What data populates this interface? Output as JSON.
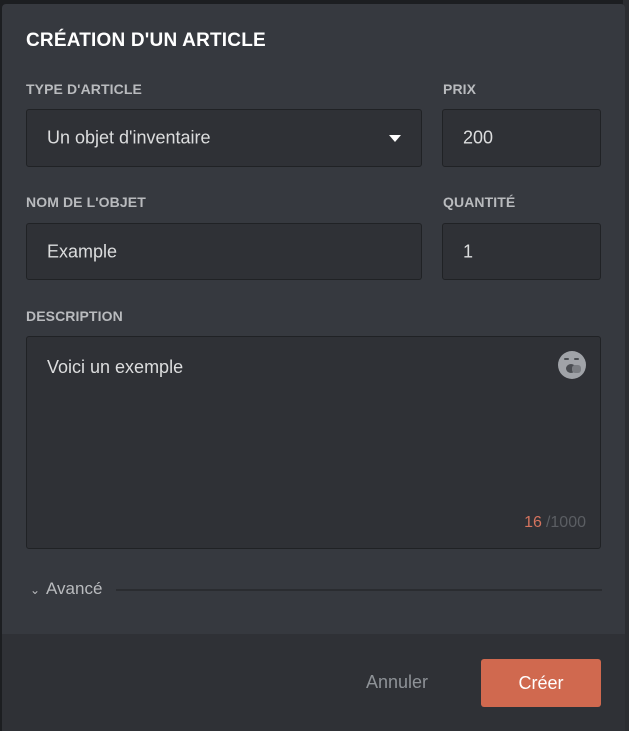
{
  "modal": {
    "title": "CRÉATION D'UN ARTICLE"
  },
  "form": {
    "type": {
      "label": "TYPE D'ARTICLE",
      "value": "Un objet d'inventaire"
    },
    "price": {
      "label": "PRIX",
      "value": "200"
    },
    "name": {
      "label": "NOM DE L'OBJET",
      "value": "Example"
    },
    "quantity": {
      "label": "QUANTITÉ",
      "value": "1"
    },
    "description": {
      "label": "DESCRIPTION",
      "value": "Voici un exemple",
      "count": "16",
      "max": "/1000"
    },
    "advanced": {
      "label": "Avancé"
    }
  },
  "footer": {
    "cancel_label": "Annuler",
    "create_label": "Créer"
  },
  "icons": {
    "dropdown": "chevron-down-icon",
    "emoji": "emoji-icon",
    "advanced": "chevron-down-icon"
  },
  "colors": {
    "accent": "#d0694f",
    "counter_current": "#d4735e"
  }
}
